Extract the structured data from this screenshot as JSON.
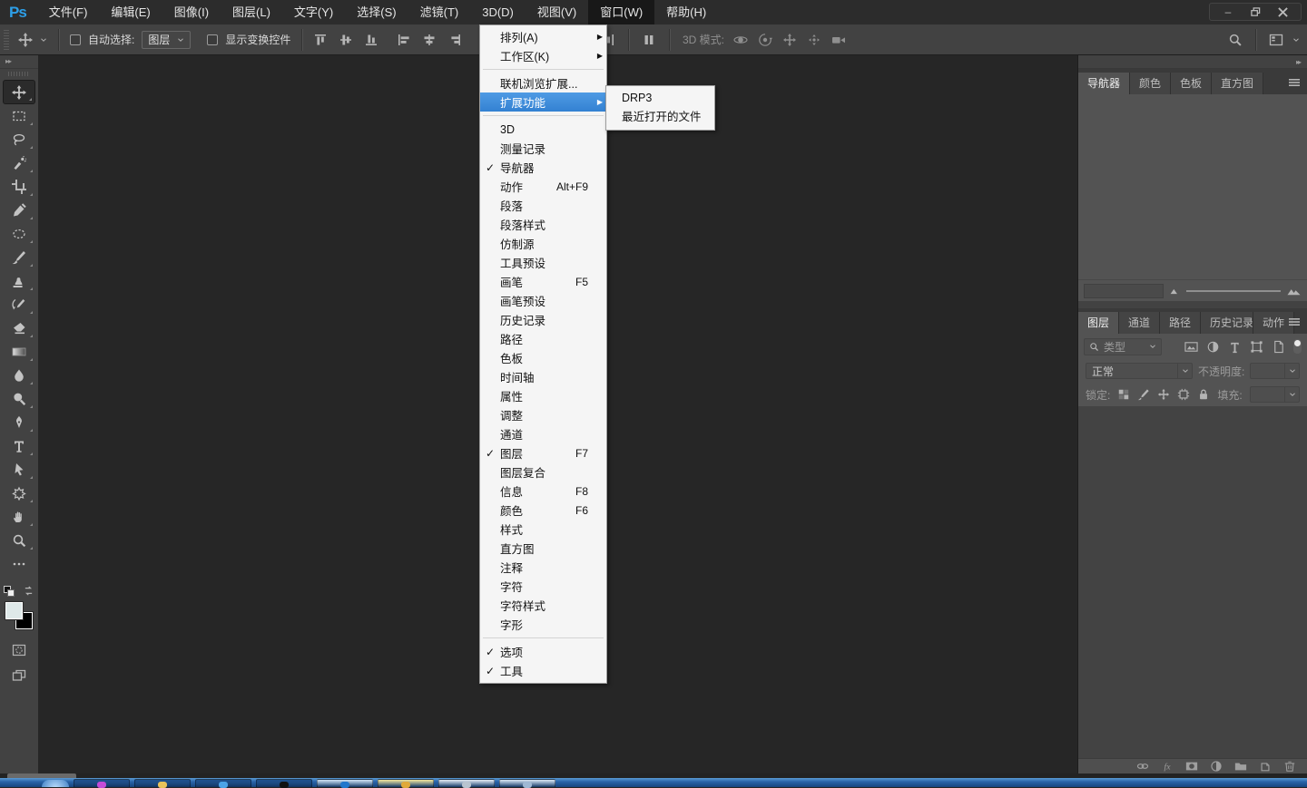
{
  "menubar": {
    "logo": "Ps",
    "menus": [
      "文件(F)",
      "编辑(E)",
      "图像(I)",
      "图层(L)",
      "文字(Y)",
      "选择(S)",
      "滤镜(T)",
      "3D(D)",
      "视图(V)",
      "窗口(W)",
      "帮助(H)"
    ],
    "active_menu": "窗口(W)"
  },
  "options_bar": {
    "auto_select_label": "自动选择:",
    "auto_select_value": "图层",
    "show_transform_label": "显示变换控件",
    "mode_3d_label": "3D 模式:"
  },
  "toolbar": {
    "tools": [
      {
        "name": "move-tool",
        "selected": true
      },
      {
        "name": "rectangular-marquee-tool",
        "selected": false
      },
      {
        "name": "lasso-tool",
        "selected": false
      },
      {
        "name": "quick-selection-tool",
        "selected": false
      },
      {
        "name": "crop-tool",
        "selected": false
      },
      {
        "name": "eyedropper-tool",
        "selected": false
      },
      {
        "name": "spot-healing-brush-tool",
        "selected": false
      },
      {
        "name": "brush-tool",
        "selected": false
      },
      {
        "name": "clone-stamp-tool",
        "selected": false
      },
      {
        "name": "history-brush-tool",
        "selected": false
      },
      {
        "name": "eraser-tool",
        "selected": false
      },
      {
        "name": "gradient-tool",
        "selected": false
      },
      {
        "name": "blur-tool",
        "selected": false
      },
      {
        "name": "dodge-tool",
        "selected": false
      },
      {
        "name": "pen-tool",
        "selected": false
      },
      {
        "name": "type-tool",
        "selected": false
      },
      {
        "name": "path-selection-tool",
        "selected": false
      },
      {
        "name": "custom-shape-tool",
        "selected": false
      },
      {
        "name": "hand-tool",
        "selected": false
      },
      {
        "name": "zoom-tool",
        "selected": false
      },
      {
        "name": "edit-toolbar-button",
        "selected": false
      }
    ],
    "foreground_color": "#dfe9e9",
    "background_color": "#000000"
  },
  "window_menu": {
    "items": [
      {
        "label": "排列(A)",
        "submenu": true
      },
      {
        "label": "工作区(K)",
        "submenu": true,
        "separator_after": true
      },
      {
        "label": "联机浏览扩展..."
      },
      {
        "label": "扩展功能",
        "submenu": true,
        "highlighted": true,
        "separator_after": true
      },
      {
        "label": "3D"
      },
      {
        "label": "测量记录"
      },
      {
        "label": "导航器",
        "checked": true
      },
      {
        "label": "动作",
        "shortcut": "Alt+F9"
      },
      {
        "label": "段落"
      },
      {
        "label": "段落样式"
      },
      {
        "label": "仿制源"
      },
      {
        "label": "工具预设"
      },
      {
        "label": "画笔",
        "shortcut": "F5"
      },
      {
        "label": "画笔预设"
      },
      {
        "label": "历史记录"
      },
      {
        "label": "路径"
      },
      {
        "label": "色板"
      },
      {
        "label": "时间轴"
      },
      {
        "label": "属性"
      },
      {
        "label": "调整"
      },
      {
        "label": "通道"
      },
      {
        "label": "图层",
        "checked": true,
        "shortcut": "F7"
      },
      {
        "label": "图层复合"
      },
      {
        "label": "信息",
        "shortcut": "F8"
      },
      {
        "label": "颜色",
        "shortcut": "F6"
      },
      {
        "label": "样式"
      },
      {
        "label": "直方图"
      },
      {
        "label": "注释"
      },
      {
        "label": "字符"
      },
      {
        "label": "字符样式"
      },
      {
        "label": "字形",
        "separator_after": true
      },
      {
        "label": "选项",
        "checked": true
      },
      {
        "label": "工具",
        "checked": true
      }
    ]
  },
  "extensions_submenu": {
    "items": [
      "DRP3",
      "最近打开的文件"
    ]
  },
  "navigator_panel": {
    "tabs": [
      "导航器",
      "颜色",
      "色板",
      "直方图"
    ],
    "active_tab": "导航器"
  },
  "layers_panel": {
    "tabs": [
      "图层",
      "通道",
      "路径",
      "历史记录",
      "动作"
    ],
    "active_tab": "图层",
    "filter_label": "类型",
    "blend_mode": "正常",
    "opacity_label": "不透明度:",
    "lock_label": "锁定:",
    "fill_label": "填充:"
  },
  "taskbar": {
    "buttons": [
      {
        "bg": "#1d4f8c",
        "dot": "#c44bd8"
      },
      {
        "bg": "#1d4f8c",
        "dot": "#e8c25a"
      },
      {
        "bg": "#1d4f8c",
        "dot": "#4aa3e8"
      },
      {
        "bg": "#1d4f8c",
        "dot": "#111111"
      },
      {
        "bg": "#cfe2f2",
        "dot": "#2277cc"
      },
      {
        "bg": "#f2e49a",
        "dot": "#e0a93a"
      },
      {
        "bg": "#e2e9f0",
        "dot": "#b8c4d0"
      },
      {
        "bg": "#d8e4f0",
        "dot": "#9fb8d4"
      }
    ]
  },
  "colors": {
    "menu_highlight": "#3b8fdd",
    "ps_logo_blue": "#2d9fe8",
    "chrome_bg": "#424242",
    "panel_bg": "#535353",
    "canvas_bg": "#262626",
    "menubar_bg": "#2c2c2c",
    "menu_popup_bg": "#f5f5f5"
  }
}
